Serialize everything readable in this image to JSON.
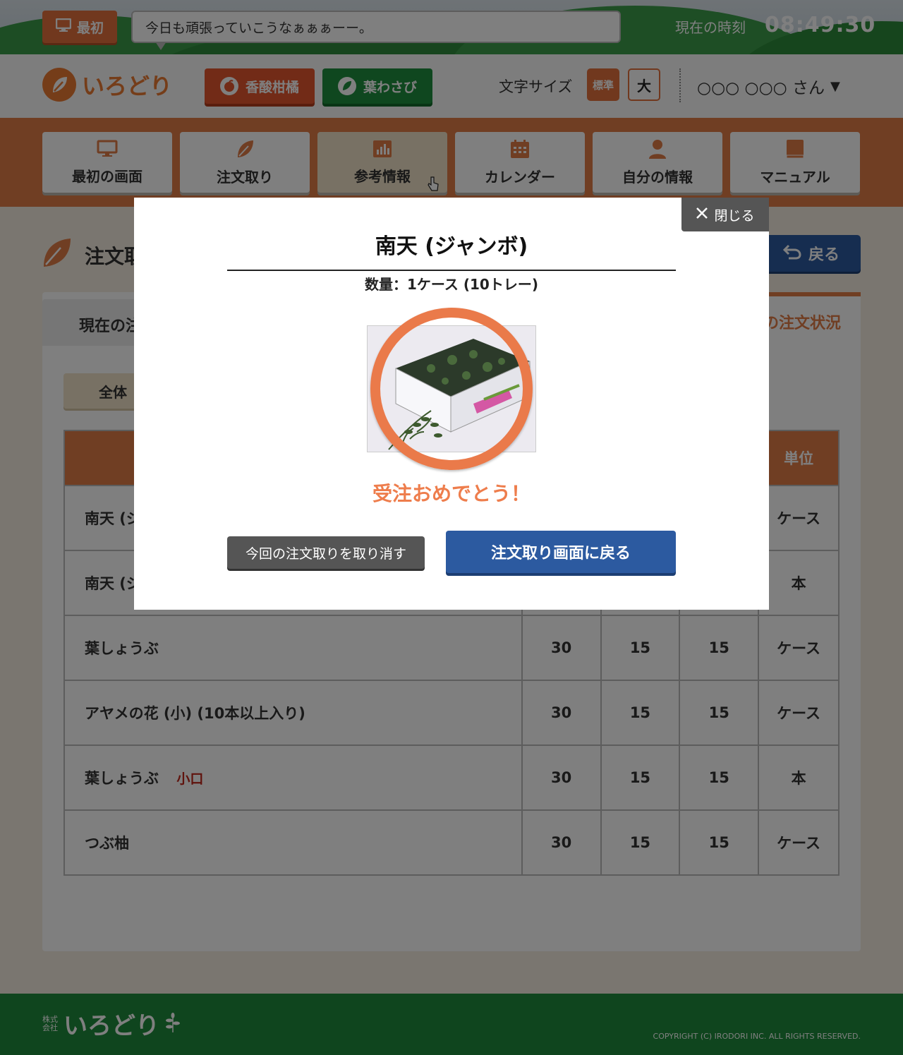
{
  "topbar": {
    "home_label": "最初",
    "message": "今日も頑張っていこうなぁぁぁーー。",
    "clock_label": "現在の時刻",
    "clock_time": "08:49:30"
  },
  "header": {
    "logo_text": "いろどり",
    "categories": [
      {
        "label": "香酸柑橘",
        "color": "#e5572f"
      },
      {
        "label": "葉わさび",
        "color": "#1f8f3e"
      }
    ],
    "font_size_label": "文字サイズ",
    "font_size_standard": "標準",
    "font_size_large": "大",
    "user_name": "○○○ ○○○ さん",
    "user_caret": "▼"
  },
  "nav": {
    "items": [
      {
        "label": "最初の画面",
        "icon": "monitor-icon"
      },
      {
        "label": "注文取り",
        "icon": "leaf-icon"
      },
      {
        "label": "参考情報",
        "icon": "chart-icon",
        "active": true
      },
      {
        "label": "カレンダー",
        "icon": "calendar-icon"
      },
      {
        "label": "自分の情報",
        "icon": "person-icon"
      },
      {
        "label": "マニュアル",
        "icon": "book-icon"
      }
    ]
  },
  "main": {
    "title": "注文取",
    "back_label": "戻る",
    "tab_current": "現在の注",
    "tab_status": "の注文状況",
    "filter_all": "全体",
    "table": {
      "unit_header": "単位",
      "rows": [
        {
          "name": "南天 (ジ",
          "c1": "",
          "c2": "",
          "c3": "",
          "unit": "ケース"
        },
        {
          "name": "南天 (ジ",
          "c1": "",
          "c2": "",
          "c3": "",
          "unit": "本"
        },
        {
          "name": "葉しょうぶ",
          "c1": "30",
          "c2": "15",
          "c3": "15",
          "unit": "ケース"
        },
        {
          "name": "アヤメの花 (小) (10本以上入り)",
          "c1": "30",
          "c2": "15",
          "c3": "15",
          "unit": "ケース"
        },
        {
          "name": "葉しょうぶ",
          "tag": "小口",
          "c1": "30",
          "c2": "15",
          "c3": "15",
          "unit": "本"
        },
        {
          "name": "つぶ柚",
          "c1": "30",
          "c2": "15",
          "c3": "15",
          "unit": "ケース"
        }
      ]
    }
  },
  "modal": {
    "close_label": "閉じる",
    "product_title": "南天 (ジャンボ)",
    "quantity": "数量：1ケース (10トレー)",
    "congrats": "受注おめでとう！",
    "cancel_label": "今回の注文取りを取り消す",
    "return_label": "注文取り画面に戻る"
  },
  "footer": {
    "company_prefix": "株式会社",
    "logo_text": "いろどり",
    "copyright": "COPYRIGHT (C) IRODORI INC. ALL RIGHTS RESERVED."
  }
}
